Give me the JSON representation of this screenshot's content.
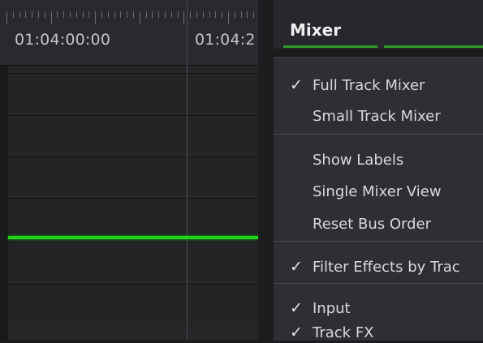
{
  "timeline": {
    "timecodes": [
      "01:04:00:00",
      "01:04:2"
    ]
  },
  "mixer": {
    "title": "Mixer",
    "menu": {
      "items": [
        {
          "label": "Full Track Mixer",
          "checked": true
        },
        {
          "label": "Small Track Mixer",
          "checked": false
        },
        {
          "label": "Show Labels",
          "checked": false
        },
        {
          "label": "Single Mixer View",
          "checked": false
        },
        {
          "label": "Reset Bus Order",
          "checked": false
        },
        {
          "label": "Filter Effects by Trac",
          "checked": true
        },
        {
          "label": "Input",
          "checked": true
        },
        {
          "label": "Track FX",
          "checked": true
        }
      ],
      "check_glyph": "✓"
    }
  },
  "colors": {
    "level_line": "#1fd615",
    "header_accent": "#2e9a2a"
  }
}
